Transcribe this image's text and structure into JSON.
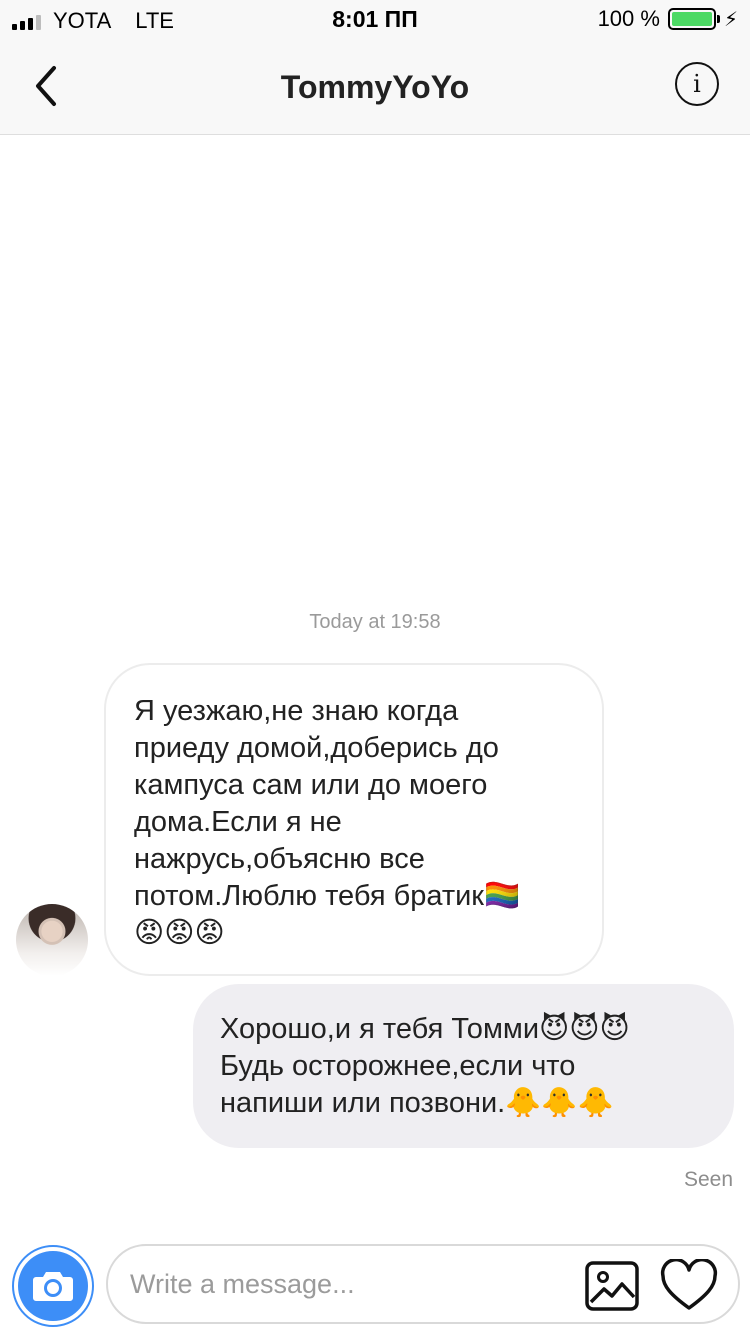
{
  "status_bar": {
    "carrier": "YOTA",
    "network": "LTE",
    "time": "8:01 ПП",
    "battery": "100 %",
    "battery_level": 1.0
  },
  "header": {
    "title": "TommyYoYo"
  },
  "conversation": {
    "timestamp": "Today at 19:58",
    "messages": [
      {
        "direction": "incoming",
        "text": "Я уезжаю,не знаю когда\nприеду домой,доберись до\nкампуса сам или до моего\nдома.Если я не\nнажрусь,объясню все\nпотом.Люблю тебя братик🏳️‍🌈\n😡😡😡"
      },
      {
        "direction": "outgoing",
        "text": "Хорошо,и я тебя Томми😈😈😈\nБудь осторожнее,если что\nнапиши или позвони.🐥🐥🐥"
      }
    ],
    "seen_label": "Seen"
  },
  "composer": {
    "placeholder": "Write a message..."
  },
  "icons": {
    "back": "chevron-left-icon",
    "info": "info-icon",
    "camera": "camera-icon",
    "gallery": "image-icon",
    "like": "heart-icon"
  },
  "colors": {
    "accent": "#3d8ef7",
    "battery": "#4cd964",
    "outgoing_bubble": "#efeef2"
  }
}
